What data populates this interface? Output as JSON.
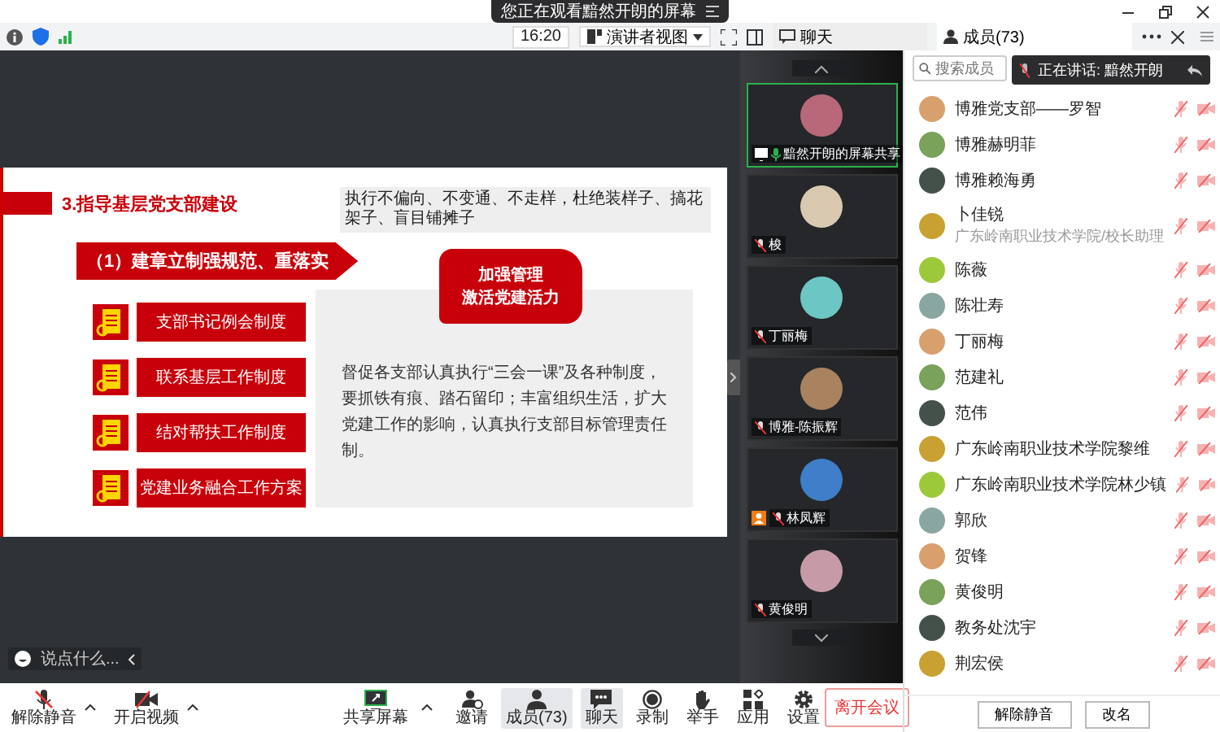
{
  "banner": {
    "text": "您正在观看黯然开朗的屏幕"
  },
  "toolbar": {
    "time": "16:20",
    "view": "演讲者视图",
    "tabs": [
      {
        "label": "聊天",
        "kind": "chat",
        "selected": false
      },
      {
        "label": "成员(73)",
        "kind": "members",
        "selected": true
      }
    ]
  },
  "slide": {
    "title": "3.指导基层党支部建设",
    "note": "执行不偏向、不变通、不走样，杜绝装样子、搞花架子、盲目铺摊子",
    "subtitle": "（1）建章立制强规范、重落实",
    "flag": [
      "加强管理",
      "激活党建活力"
    ],
    "items": [
      "支部书记例会制度",
      "联系基层工作制度",
      "结对帮扶工作制度",
      "党建业务融合工作方案"
    ],
    "paragraph": "督促各支部认真执行“三会一课”及各种制度，要抓铁有痕、踏石留印；丰富组织生活，扩大党建工作的影响，认真执行支部目标管理责任制。"
  },
  "chat_input": {
    "placeholder": "说点什么..."
  },
  "video_tiles": [
    {
      "name": "黯然开朗的屏幕共享",
      "kind": "presenter",
      "host": false
    },
    {
      "name": "梭",
      "kind": "muted",
      "host": false
    },
    {
      "name": "丁丽梅",
      "kind": "muted",
      "host": false
    },
    {
      "name": "博雅-陈振辉",
      "kind": "muted",
      "host": false
    },
    {
      "name": "林凤辉",
      "kind": "muted",
      "host": true
    },
    {
      "name": "黄俊明",
      "kind": "muted",
      "host": false
    }
  ],
  "members": {
    "search_placeholder": "搜索成员",
    "speaking": "正在讲话: 黯然开朗",
    "items": [
      {
        "name": "博雅党支部——罗智"
      },
      {
        "name": "博雅赫明菲"
      },
      {
        "name": "博雅赖海勇"
      },
      {
        "name": "卜佳锐",
        "subtitle": "广东岭南职业技术学院/校长助理"
      },
      {
        "name": "陈薇"
      },
      {
        "name": "陈壮寿"
      },
      {
        "name": "丁丽梅"
      },
      {
        "name": "范建礼"
      },
      {
        "name": "范伟"
      },
      {
        "name": "广东岭南职业技术学院黎维"
      },
      {
        "name": "广东岭南职业技术学院林少镇"
      },
      {
        "name": "郭欣"
      },
      {
        "name": "贺锋"
      },
      {
        "name": "黄俊明"
      },
      {
        "name": "教务处沈宇"
      },
      {
        "name": "荆宏侯"
      }
    ],
    "buttons": [
      "解除静音",
      "改名"
    ]
  },
  "bottom_toolbar": [
    {
      "label": "解除静音",
      "kind": "mic",
      "selected": false,
      "menu": true
    },
    {
      "label": "开启视频",
      "kind": "video",
      "selected": false,
      "menu": true
    },
    {
      "label": "共享屏幕",
      "kind": "share",
      "selected": false,
      "menu": true
    },
    {
      "label": "邀请",
      "kind": "invite",
      "selected": false,
      "menu": false
    },
    {
      "label": "成员(73)",
      "kind": "members",
      "selected": true,
      "menu": false
    },
    {
      "label": "聊天",
      "kind": "chat",
      "selected": true,
      "menu": false
    },
    {
      "label": "录制",
      "kind": "record",
      "selected": false,
      "menu": false
    },
    {
      "label": "举手",
      "kind": "hand",
      "selected": false,
      "menu": false
    },
    {
      "label": "应用",
      "kind": "apps",
      "selected": false,
      "menu": false
    },
    {
      "label": "设置",
      "kind": "settings",
      "selected": false,
      "menu": false
    }
  ],
  "leave_button": "离开会议"
}
